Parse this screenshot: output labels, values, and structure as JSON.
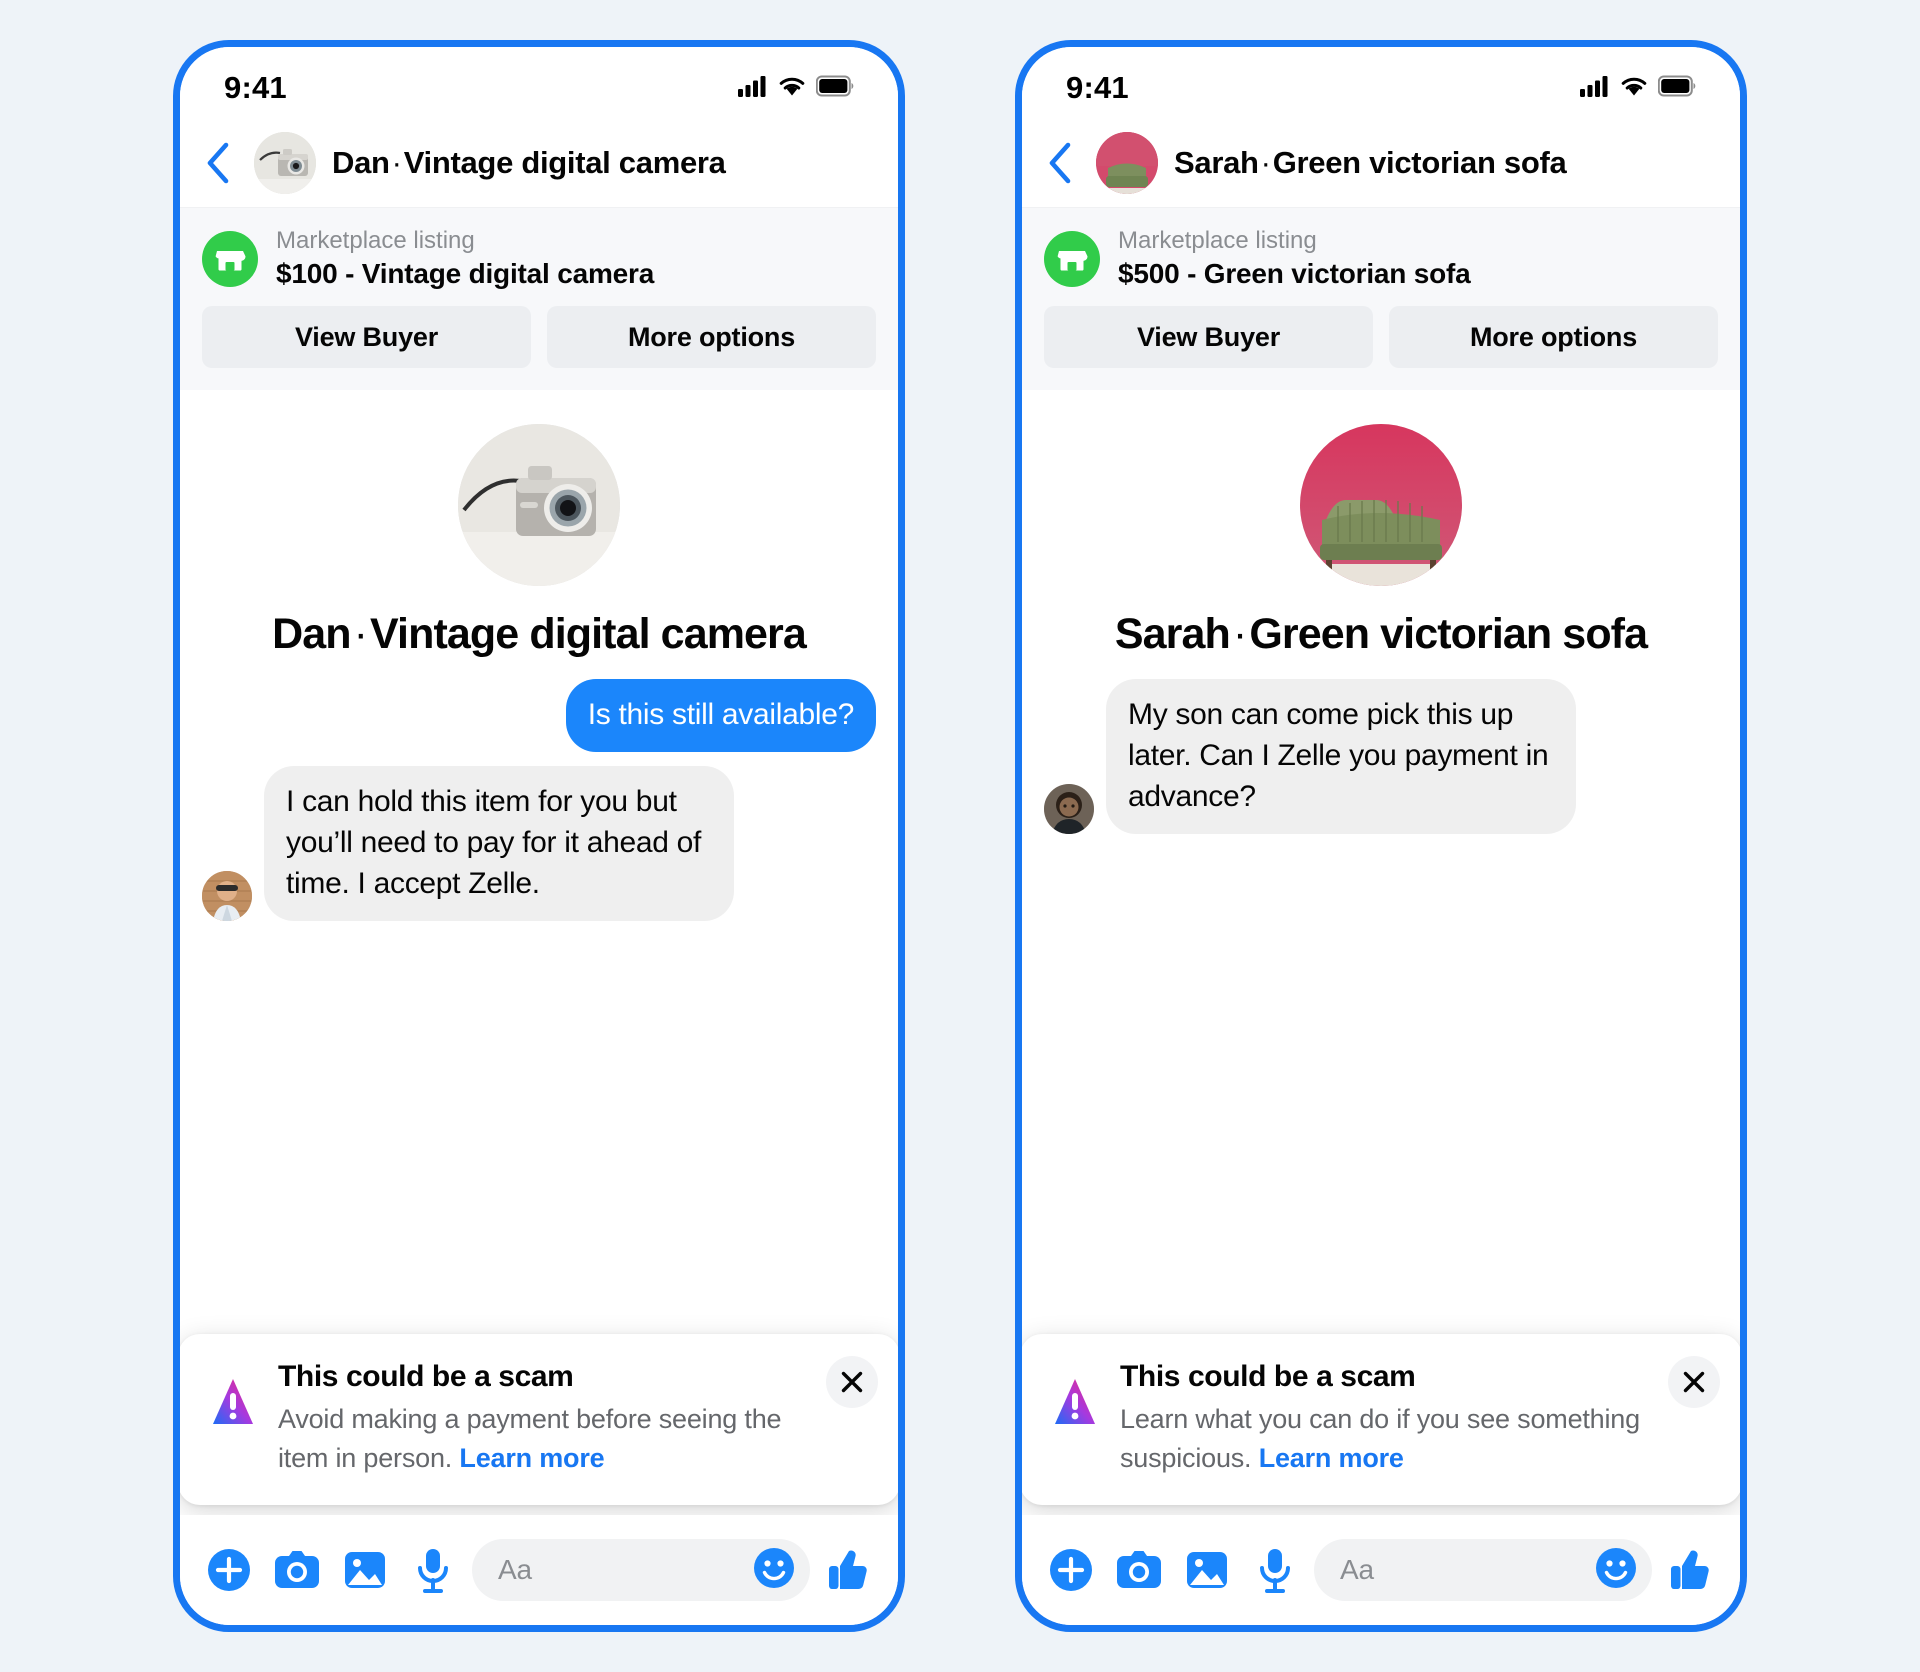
{
  "theme": {
    "accent": "#1877f2",
    "bubble_out": "#1b86fb",
    "bubble_in": "#efefef",
    "marketplace_green": "#31cc4a",
    "page_bg": "#eef3f8",
    "muted_text": "#8a8d91"
  },
  "phones": [
    {
      "status": {
        "time": "9:41",
        "cellular": "signal-bars-icon",
        "wifi": "wifi-icon",
        "battery": "battery-full-icon"
      },
      "header": {
        "back": "back-chevron-icon",
        "avatar": "camera-listing-thumbnail",
        "name": "Dan",
        "separator": "·",
        "item": "Vintage digital camera"
      },
      "marketplace": {
        "icon": "marketplace-storefront-icon",
        "subtitle": "Marketplace listing",
        "title": "$100 - Vintage digital camera",
        "price": "$100",
        "buttons": [
          {
            "label": "View Buyer",
            "name": "view-buyer-button"
          },
          {
            "label": "More options",
            "name": "more-options-button"
          }
        ]
      },
      "hero": {
        "image": "vintage-digital-camera-photo",
        "name": "Dan",
        "separator": "·",
        "item": "Vintage digital camera"
      },
      "messages": [
        {
          "side": "out",
          "text": "Is this still available?",
          "avatar": null
        },
        {
          "side": "in",
          "text": "I can hold this item for you but you’ll need to pay for it ahead of time. I accept Zelle.",
          "avatar": "dan-profile-photo"
        }
      ],
      "warning": {
        "icon": "warning-triangle-icon",
        "title": "This could be a scam",
        "body": "Avoid making a payment before seeing the item in person.",
        "link": "Learn more",
        "close": "close-icon"
      },
      "composer": {
        "icons": [
          {
            "name": "plus-circle-icon",
            "label": "plus"
          },
          {
            "name": "camera-icon",
            "label": "camera"
          },
          {
            "name": "photo-gallery-icon",
            "label": "gallery"
          },
          {
            "name": "microphone-icon",
            "label": "microphone"
          }
        ],
        "placeholder": "Aa",
        "emoji_icon": "emoji-smiley-icon",
        "like_icon": "thumbs-up-icon"
      }
    },
    {
      "status": {
        "time": "9:41",
        "cellular": "signal-bars-icon",
        "wifi": "wifi-icon",
        "battery": "battery-full-icon"
      },
      "header": {
        "back": "back-chevron-icon",
        "avatar": "sofa-listing-thumbnail",
        "name": "Sarah",
        "separator": "·",
        "item": "Green victorian sofa"
      },
      "marketplace": {
        "icon": "marketplace-storefront-icon",
        "subtitle": "Marketplace listing",
        "title": "$500 - Green victorian sofa",
        "price": "$500",
        "buttons": [
          {
            "label": "View Buyer",
            "name": "view-buyer-button"
          },
          {
            "label": "More options",
            "name": "more-options-button"
          }
        ]
      },
      "hero": {
        "image": "green-victorian-sofa-photo",
        "name": "Sarah",
        "separator": "·",
        "item": "Green victorian sofa"
      },
      "messages": [
        {
          "side": "in",
          "text": "My son can come pick this up later. Can I Zelle you payment in advance?",
          "avatar": "sarah-profile-photo"
        }
      ],
      "warning": {
        "icon": "warning-triangle-icon",
        "title": "This could be a scam",
        "body": "Learn what you can do if you see something suspicious.",
        "link": "Learn more",
        "close": "close-icon"
      },
      "composer": {
        "icons": [
          {
            "name": "plus-circle-icon",
            "label": "plus"
          },
          {
            "name": "camera-icon",
            "label": "camera"
          },
          {
            "name": "photo-gallery-icon",
            "label": "gallery"
          },
          {
            "name": "microphone-icon",
            "label": "microphone"
          }
        ],
        "placeholder": "Aa",
        "emoji_icon": "emoji-smiley-icon",
        "like_icon": "thumbs-up-icon"
      }
    }
  ]
}
